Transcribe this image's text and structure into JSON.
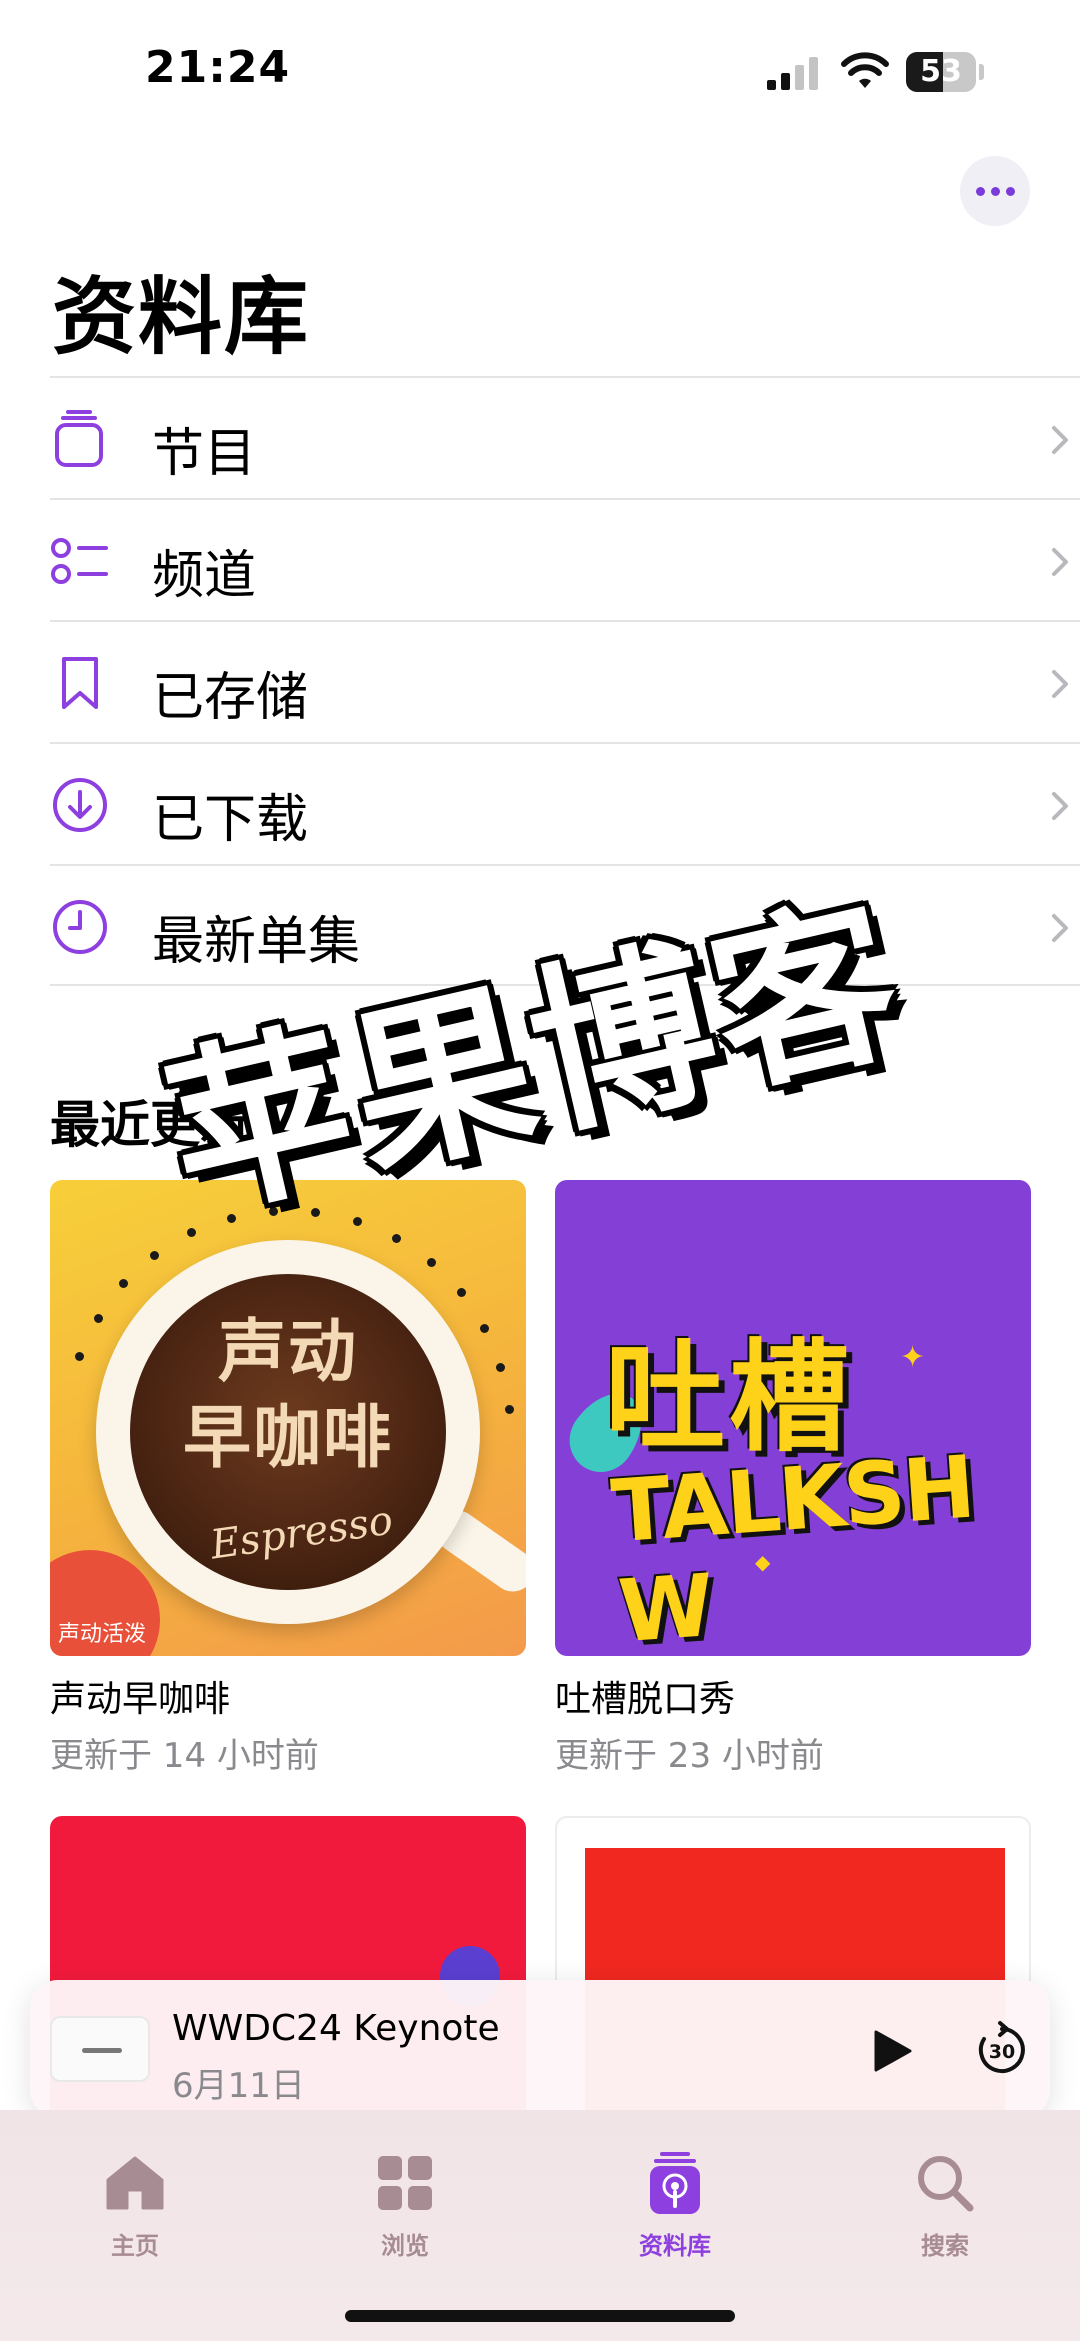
{
  "status_bar": {
    "time": "21:24",
    "battery_level": "53",
    "battery_fraction": 0.53
  },
  "header": {
    "title": "资料库",
    "more_icon": "ellipsis-icon"
  },
  "library_items": [
    {
      "label": "节目",
      "icon": "shows-stack-icon"
    },
    {
      "label": "频道",
      "icon": "channels-list-icon"
    },
    {
      "label": "已存储",
      "icon": "bookmark-icon"
    },
    {
      "label": "已下载",
      "icon": "download-circle-icon"
    },
    {
      "label": "最新单集",
      "icon": "clock-icon"
    }
  ],
  "section": {
    "title": "最近更新"
  },
  "shows": [
    {
      "title": "声动早咖啡",
      "updated": "更新于 14 小时前",
      "art_lines": [
        "声动",
        "早咖啡"
      ],
      "art_script": "Espresso",
      "art_badge": "声动活泼"
    },
    {
      "title": "吐槽脱口秀",
      "updated": "更新于 23 小时前",
      "art_top": "吐槽",
      "art_bottom": "TALKSH W"
    },
    {
      "title": "",
      "updated": ""
    },
    {
      "title": "",
      "updated": ""
    }
  ],
  "watermark": "苹果博客",
  "now_playing": {
    "title": "WWDC24 Keynote",
    "date": "6月11日",
    "play_icon": "play-icon",
    "skip_icon": "skip-forward-30-icon"
  },
  "tabs": [
    {
      "label": "主页",
      "icon": "home-icon",
      "active": false
    },
    {
      "label": "浏览",
      "icon": "grid-icon",
      "active": false
    },
    {
      "label": "资料库",
      "icon": "library-podcast-icon",
      "active": true
    },
    {
      "label": "搜索",
      "icon": "search-icon",
      "active": false
    }
  ],
  "colors": {
    "accent": "#8e3fe0",
    "separator": "#e4e4e7",
    "secondary_text": "#8a8a8e"
  }
}
